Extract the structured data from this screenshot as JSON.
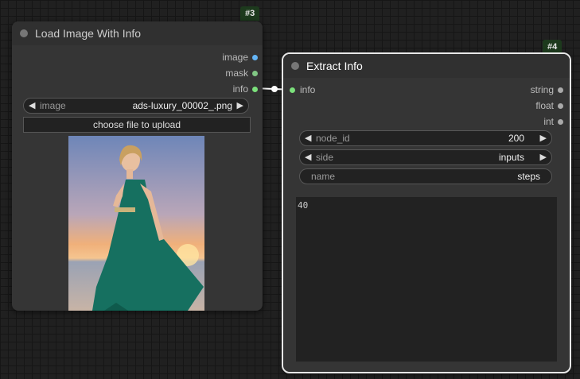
{
  "node1": {
    "badge": "#3",
    "title": "Load Image With Info",
    "outputs": [
      {
        "label": "image",
        "color": "#64b5f6"
      },
      {
        "label": "mask",
        "color": "#81c784"
      },
      {
        "label": "info",
        "color": "#7be07b"
      }
    ],
    "image_widget": {
      "label": "image",
      "value": "ads-luxury_00002_.png"
    },
    "upload_button": "choose file to upload"
  },
  "node2": {
    "badge": "#4",
    "title": "Extract Info",
    "input": {
      "label": "info",
      "color": "#7be07b"
    },
    "outputs": [
      {
        "label": "string",
        "color": "#aaaaaa"
      },
      {
        "label": "float",
        "color": "#aaaaaa"
      },
      {
        "label": "int",
        "color": "#aaaaaa"
      }
    ],
    "widgets": [
      {
        "label": "node_id",
        "value": "200"
      },
      {
        "label": "side",
        "value": "inputs"
      },
      {
        "label": "name",
        "value": "steps"
      }
    ],
    "output_text": "40"
  },
  "arrows": {
    "left": "◀",
    "right": "▶"
  }
}
